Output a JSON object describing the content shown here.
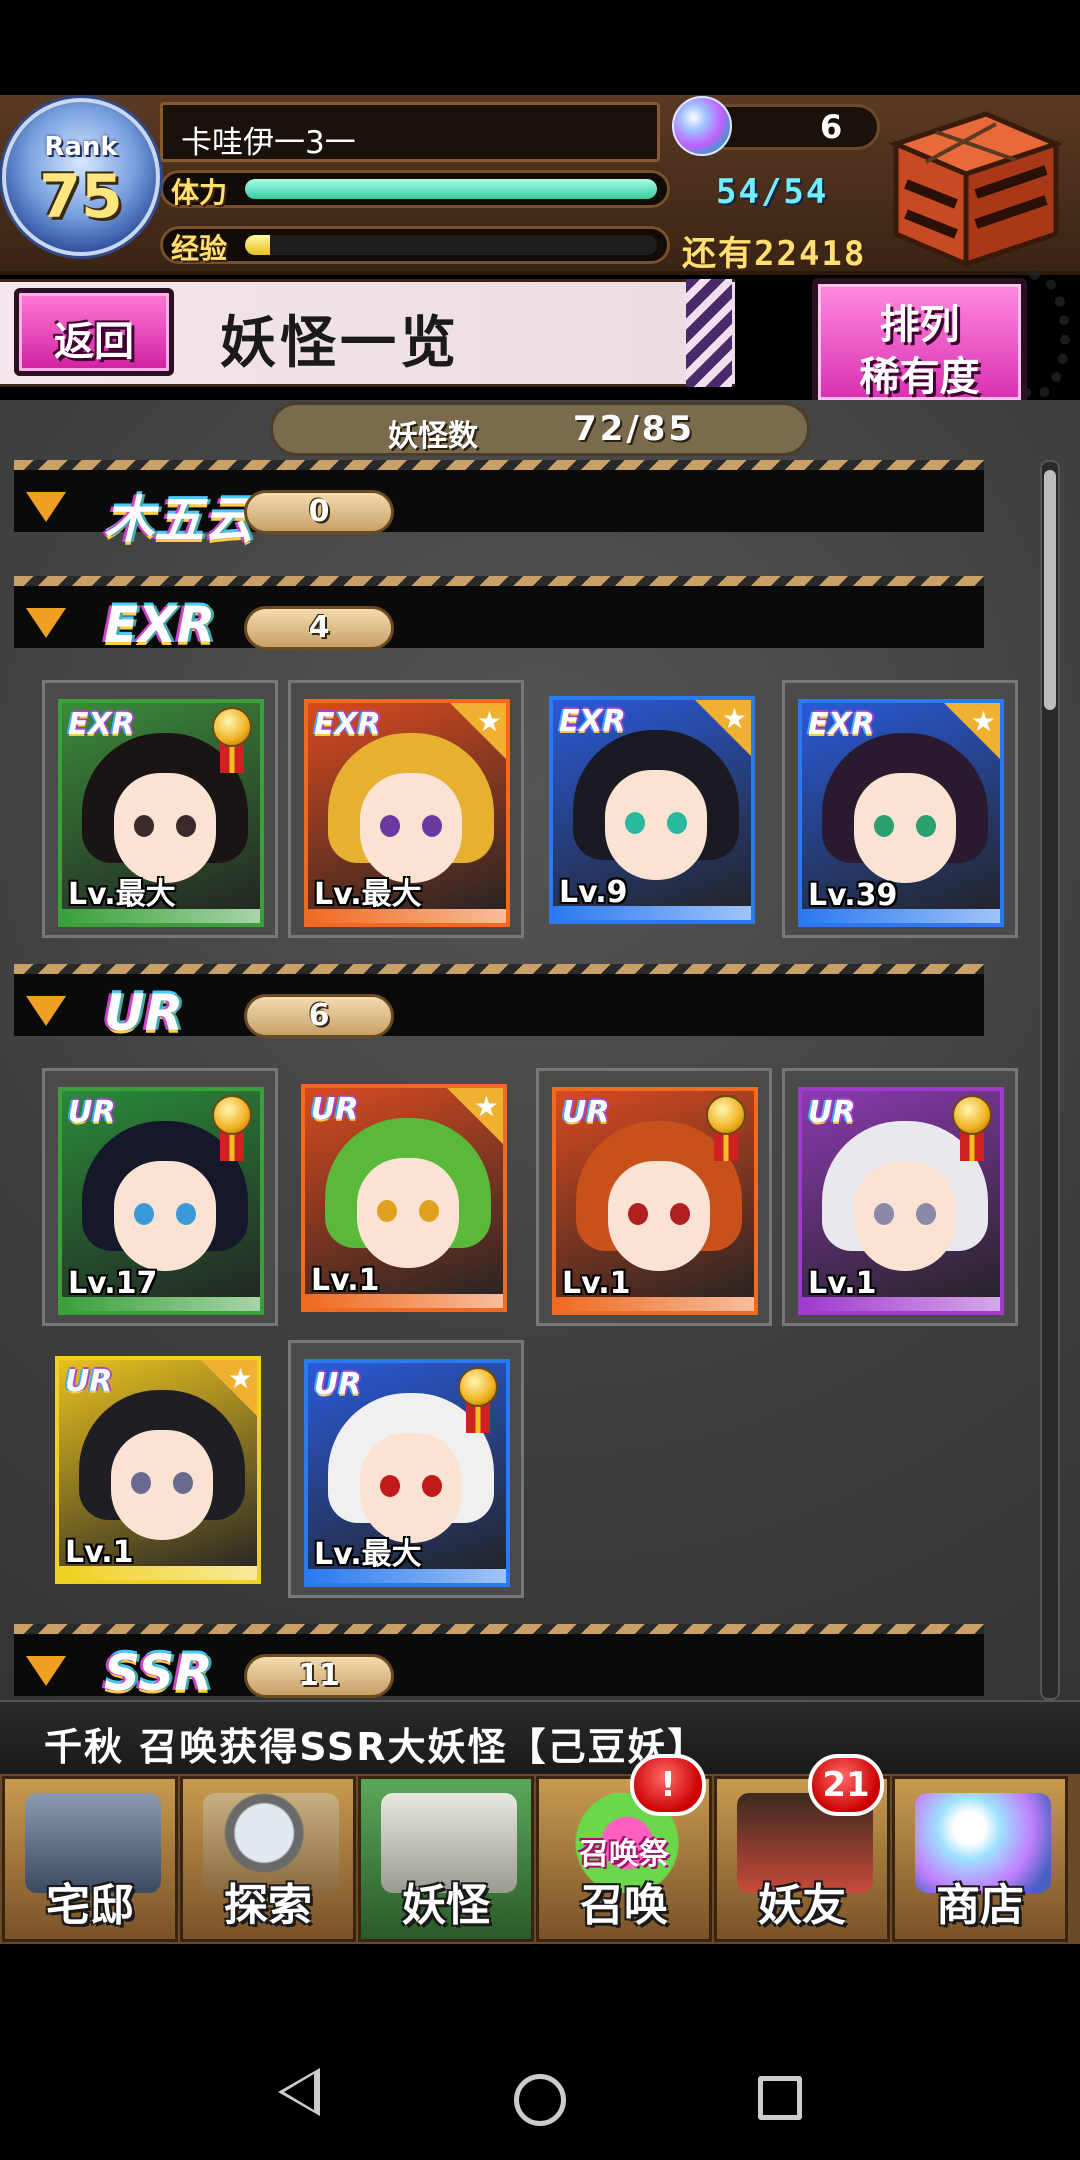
{
  "player": {
    "rank_label": "Rank",
    "rank": "75",
    "name": "卡哇伊一3一",
    "stamina_label": "体力",
    "stamina_text": "54/54",
    "stamina_fraction": 1.0,
    "exp_label": "经验",
    "exp_fraction": 0.06,
    "exp_remaining_text": "还有22418",
    "gems": "6"
  },
  "titlebar": {
    "back_label": "返回",
    "title": "妖怪一览",
    "sort_line1": "排列",
    "sort_line2": "稀有度"
  },
  "collection": {
    "count_label": "妖怪数",
    "count_value": "72/85"
  },
  "sections": [
    {
      "rarity": "木五云",
      "count": "0"
    },
    {
      "rarity": "EXR",
      "count": "4"
    },
    {
      "rarity": "UR",
      "count": "6"
    },
    {
      "rarity": "SSR",
      "count": "11"
    }
  ],
  "cards": [
    {
      "badge": "EXR",
      "level": "Lv.最大",
      "corner": "medal"
    },
    {
      "badge": "EXR",
      "level": "Lv.最大",
      "corner": "star"
    },
    {
      "badge": "EXR",
      "level": "Lv.9",
      "corner": "star"
    },
    {
      "badge": "EXR",
      "level": "Lv.39",
      "corner": "star"
    },
    {
      "badge": "UR",
      "level": "Lv.17",
      "corner": "medal"
    },
    {
      "badge": "UR",
      "level": "Lv.1",
      "corner": "star"
    },
    {
      "badge": "UR",
      "level": "Lv.1",
      "corner": "medal"
    },
    {
      "badge": "UR",
      "level": "Lv.1",
      "corner": "medal"
    },
    {
      "badge": "UR",
      "level": "Lv.1",
      "corner": "star"
    },
    {
      "badge": "UR",
      "level": "Lv.最大",
      "corner": "medal"
    }
  ],
  "ticker": "千秋 召唤获得SSR大妖怪【己豆妖】",
  "nav": [
    {
      "label": "宅邸",
      "icon": "house-icon"
    },
    {
      "label": "探索",
      "icon": "magnifier-icon"
    },
    {
      "label": "妖怪",
      "icon": "scroll-icon"
    },
    {
      "label": "召唤",
      "icon": "summon-icon",
      "badge": "!",
      "sub": "召唤祭"
    },
    {
      "label": "妖友",
      "icon": "friend-icon",
      "badge": "21"
    },
    {
      "label": "商店",
      "icon": "orb-icon"
    }
  ],
  "colors": {
    "accent_pink": "#e040b8",
    "stamina": "#38c8a0",
    "exp": "#e8c020",
    "text_cyan": "#70f0ff"
  }
}
